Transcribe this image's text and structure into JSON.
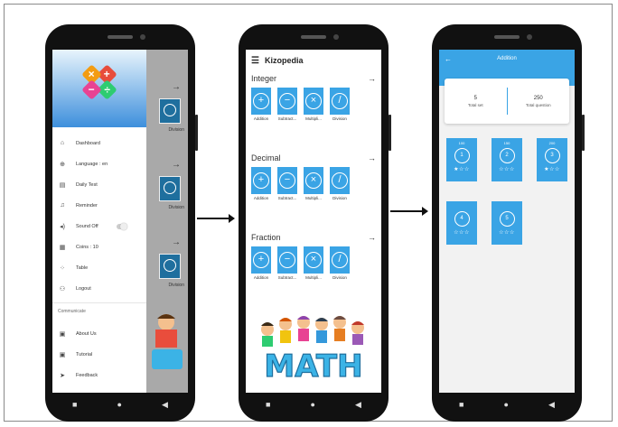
{
  "drawer": {
    "items": [
      {
        "icon": "⌂",
        "label": "Dashboard",
        "name": "home-icon"
      },
      {
        "icon": "⊕",
        "label": "Language : en",
        "name": "globe-icon"
      },
      {
        "icon": "▤",
        "label": "Daily Test",
        "name": "document-icon"
      },
      {
        "icon": "♫",
        "label": "Reminder",
        "name": "bell-icon"
      },
      {
        "icon": "◂)",
        "label": "Sound Off",
        "name": "speaker-icon",
        "toggle": true
      },
      {
        "icon": "▦",
        "label": "Coins : 10",
        "name": "coins-icon"
      },
      {
        "icon": "⁘",
        "label": "Table",
        "name": "table-icon"
      },
      {
        "icon": "⚇",
        "label": "Logout",
        "name": "logout-icon"
      }
    ],
    "communicate_label": "Communicate",
    "communicate_items": [
      {
        "icon": "▣",
        "label": "About Us",
        "name": "info-icon"
      },
      {
        "icon": "▣",
        "label": "Tutorial",
        "name": "tutorial-icon"
      },
      {
        "icon": "➤",
        "label": "Feedback",
        "name": "send-icon"
      }
    ],
    "behind_label": "Division"
  },
  "home": {
    "title": "Kizopedia",
    "sections": [
      {
        "title": "Integer"
      },
      {
        "title": "Decimal"
      },
      {
        "title": "Fraction"
      }
    ],
    "ops": [
      {
        "symbol": "+",
        "label": "Addition"
      },
      {
        "symbol": "−",
        "label": "Subtract..."
      },
      {
        "symbol": "×",
        "label": "Multipli..."
      },
      {
        "symbol": "/",
        "label": "Division"
      }
    ],
    "math_word": "MATH"
  },
  "level_screen": {
    "title": "Addition",
    "back_icon": "←",
    "stats": [
      {
        "value": "5",
        "label": "Total set"
      },
      {
        "value": "250",
        "label": "Total question"
      }
    ],
    "levels": [
      {
        "number": "1",
        "questions": "100",
        "stars": "★☆☆"
      },
      {
        "number": "2",
        "questions": "150",
        "stars": "☆☆☆"
      },
      {
        "number": "3",
        "questions": "200",
        "stars": "★☆☆"
      },
      {
        "number": "4",
        "questions": "",
        "stars": "☆☆☆"
      },
      {
        "number": "5",
        "questions": "",
        "stars": "☆☆☆"
      }
    ]
  },
  "nav": {
    "back": "◀",
    "home": "●",
    "recent": "■"
  },
  "colors": {
    "accent": "#3aa4e5",
    "drawer_gradient_end": "#3d8fdc"
  }
}
